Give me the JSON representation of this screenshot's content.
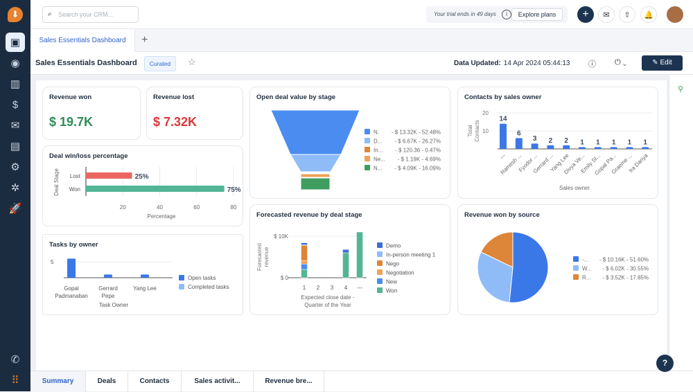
{
  "topbar": {
    "search_placeholder": "Search your CRM...",
    "trial_text": "Your trial ends in 49 days",
    "explore_label": "Explore plans"
  },
  "tabs": {
    "active": "Sales Essentials Dashboard"
  },
  "header": {
    "title": "Sales Essentials Dashboard",
    "badge": "Curated",
    "data_updated_label": "Data Updated:",
    "data_updated_value": "14 Apr 2024 05:44:13",
    "edit_label": "Edit"
  },
  "cards": {
    "revenue_won": {
      "title": "Revenue won",
      "value": "$ 19.7K",
      "color": "#2e8b57"
    },
    "revenue_lost": {
      "title": "Revenue lost",
      "value": "$ 7.32K",
      "color": "#d9383a"
    }
  },
  "chart_data": [
    {
      "id": "winloss",
      "type": "bar",
      "orientation": "horizontal",
      "title": "Deal win/loss percentage",
      "categories": [
        "Lost",
        "Won"
      ],
      "values": [
        25,
        75
      ],
      "labels": [
        "25%",
        "75%"
      ],
      "colors": [
        "#eb6663",
        "#52b596"
      ],
      "xlabel": "Percentage",
      "ylabel": "Deal Stage",
      "xticks": [
        20,
        40,
        60,
        80
      ],
      "xlim": [
        0,
        80
      ]
    },
    {
      "id": "tasks",
      "type": "bar",
      "title": "Tasks by owner",
      "categories": [
        "Gopal Padmanaban",
        "Gerrard Pepe",
        "Yang Lee"
      ],
      "series": [
        {
          "name": "Open tasks",
          "values": [
            6,
            1,
            1
          ],
          "color": "#3b78e7"
        },
        {
          "name": "Completed tasks",
          "values": [
            0,
            0,
            0
          ],
          "color": "#8fbcf7"
        }
      ],
      "xlabel": "Task Owner",
      "yticks": [
        5
      ],
      "ylim": [
        0,
        7
      ]
    },
    {
      "id": "funnel",
      "type": "funnel",
      "title": "Open deal value by stage",
      "legend": [
        {
          "label": "N.",
          "text": "- $ 13.32K - 52.48%",
          "value": 52.48,
          "color": "#4a8cf0"
        },
        {
          "label": "D...",
          "text": "- $ 6.67K - 26.27%",
          "value": 26.27,
          "color": "#8fbcf7"
        },
        {
          "label": "In...",
          "text": "- $ 120.36 - 0.47%",
          "value": 0.47,
          "color": "#dd8538"
        },
        {
          "label": "Ne...",
          "text": "- $ 1.19K - 4.69%",
          "value": 4.69,
          "color": "#efa257"
        },
        {
          "label": "N...",
          "text": "- $ 4.09K - 16.09%",
          "value": 16.09,
          "color": "#3f9e5f"
        }
      ],
      "legend_position": "right"
    },
    {
      "id": "contacts",
      "type": "bar",
      "title": "Contacts by sales owner",
      "categories": [
        "---",
        "Ramesh ...",
        "Fyodor ...",
        "Gerrard ...",
        "Yang Lee",
        "Divya Ve...",
        "Emily St...",
        "Gopal Pa...",
        "Graeme ...",
        "Ira Dariya"
      ],
      "values": [
        14,
        6,
        3,
        2,
        2,
        1,
        1,
        1,
        1,
        1
      ],
      "xlabel": "Sales owner",
      "ylabel": "Total Contacts",
      "yticks": [
        10,
        20
      ],
      "ylim": [
        0,
        20
      ],
      "color": "#3b78e7"
    },
    {
      "id": "forecast",
      "type": "bar",
      "stacked": true,
      "title": "Forecasted revenue by deal stage",
      "categories": [
        "1",
        "2",
        "3",
        "4",
        "---"
      ],
      "series": [
        {
          "name": "Won",
          "values": [
            2000,
            0,
            0,
            6000,
            11000
          ],
          "color": "#52b596"
        },
        {
          "name": "New",
          "values": [
            1300,
            0,
            0,
            0,
            0
          ],
          "color": "#4a8cf0"
        },
        {
          "name": "Negotiation",
          "values": [
            800,
            0,
            0,
            0,
            0
          ],
          "color": "#efa257"
        },
        {
          "name": "Nego",
          "values": [
            3700,
            0,
            0,
            0,
            0
          ],
          "color": "#dd8538"
        },
        {
          "name": "In-person meeting 1",
          "values": [
            100,
            0,
            0,
            0,
            0
          ],
          "color": "#8fbcf7"
        },
        {
          "name": "Demo",
          "values": [
            500,
            0,
            0,
            800,
            0
          ],
          "color": "#3b6fd8"
        }
      ],
      "legend_order": [
        "Demo",
        "In-person meeting 1",
        "Nego",
        "Negotiation",
        "New",
        "Won"
      ],
      "xlabel": "Expected close date - Quarter of the Year",
      "ylabel": "Forecasted revenue",
      "yticks": [
        "$ 0",
        "$ 10K"
      ],
      "ylim": [
        0,
        10000
      ]
    },
    {
      "id": "pie",
      "type": "pie",
      "title": "Revenue won by source",
      "slices": [
        {
          "label": "-...",
          "text": "- $ 10.16K - 51.60%",
          "value": 51.6,
          "color": "#3b78e7"
        },
        {
          "label": "W...",
          "text": "- $ 6.02K - 30.55%",
          "value": 30.55,
          "color": "#8fbcf7"
        },
        {
          "label": "R...",
          "text": "- $ 3.52K - 17.85%",
          "value": 17.85,
          "color": "#dd8538"
        }
      ],
      "legend_position": "right"
    }
  ],
  "bottom_tabs": [
    "Summary",
    "Deals",
    "Contacts",
    "Sales activit...",
    "Revenue bre..."
  ]
}
